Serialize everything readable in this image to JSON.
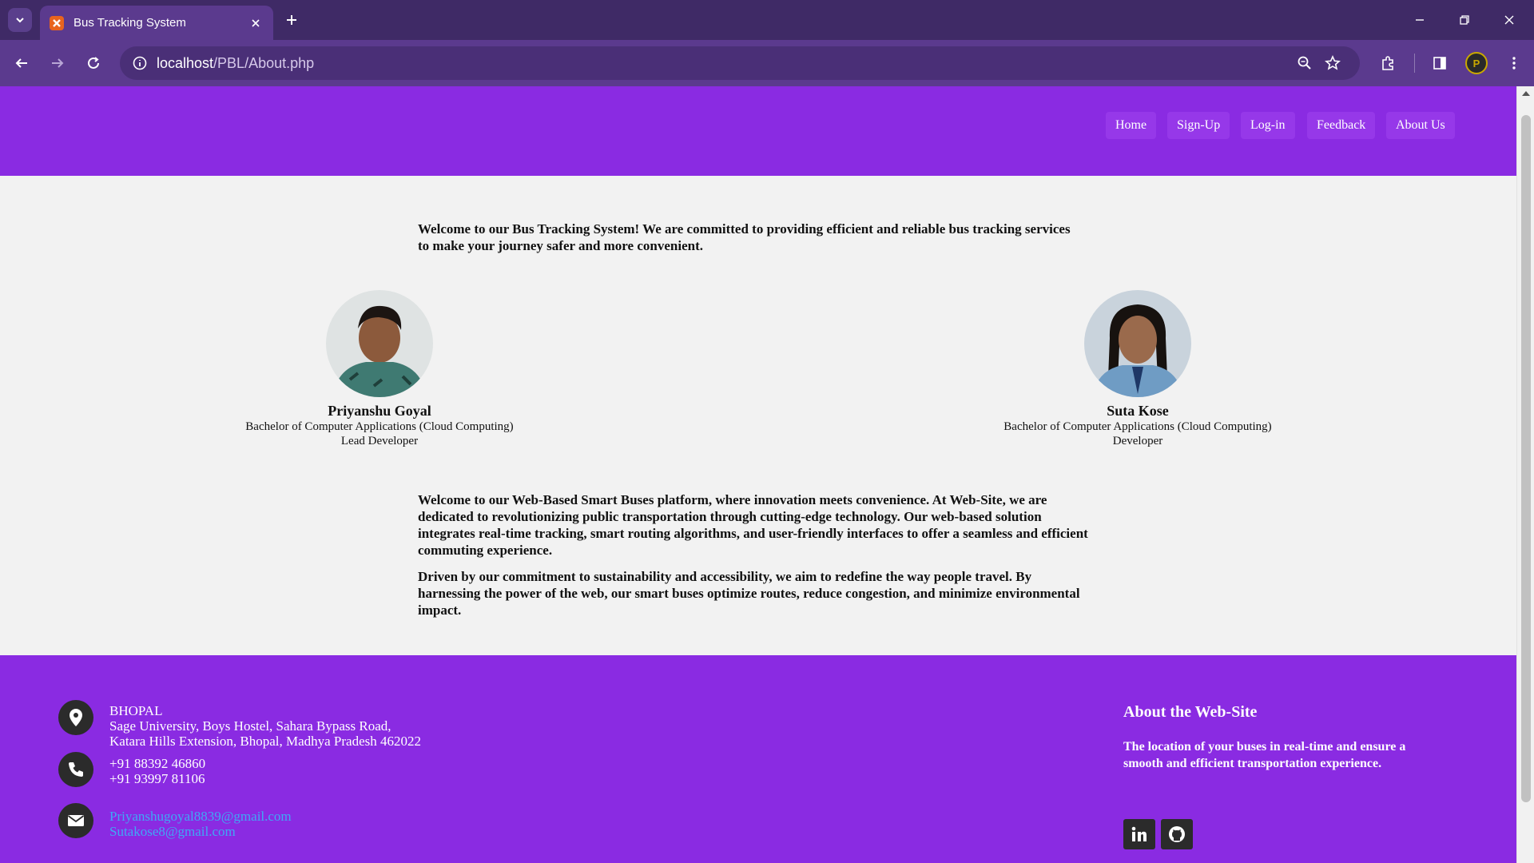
{
  "browser": {
    "tab_title": "Bus Tracking System",
    "url_host": "localhost",
    "url_path": "/PBL/About.php",
    "profile_initial": "P"
  },
  "header": {
    "nav": [
      "Home",
      "Sign-Up",
      "Log-in",
      "Feedback",
      "About Us"
    ]
  },
  "intro": "Welcome to our Bus Tracking System! We are committed to providing efficient and reliable bus tracking services to make your journey safer and more convenient.",
  "team": [
    {
      "name": "Priyanshu Goyal",
      "degree": "Bachelor of Computer Applications (Cloud Computing)",
      "role": "Lead Developer"
    },
    {
      "name": "Suta Kose",
      "degree": "Bachelor of Computer Applications (Cloud Computing)",
      "role": "Developer"
    }
  ],
  "about_paragraphs": [
    "Welcome to our Web-Based Smart Buses platform, where innovation meets convenience. At Web-Site, we are dedicated to revolutionizing public transportation through cutting-edge technology. Our web-based solution integrates real-time tracking, smart routing algorithms, and user-friendly interfaces to offer a seamless and efficient commuting experience.",
    "Driven by our commitment to sustainability and accessibility, we aim to redefine the way people travel. By harnessing the power of the web, our smart buses optimize routes, reduce congestion, and minimize environmental impact."
  ],
  "footer": {
    "address": {
      "city": "BHOPAL",
      "line1": "Sage University, Boys Hostel, Sahara Bypass Road,",
      "line2": "Katara Hills Extension, Bhopal, Madhya Pradesh 462022"
    },
    "phones": [
      "+91 88392 46860",
      "+91 93997 81106"
    ],
    "emails": [
      "Priyanshugoyal8839@gmail.com",
      "Sutakose8@gmail.com"
    ],
    "about_title": "About the Web-Site",
    "about_text": "The location of your buses in real-time and ensure a smooth and efficient transportation experience.",
    "social_icons": [
      "linkedin-icon",
      "github-icon"
    ]
  },
  "colors": {
    "browser_frame": "#3f2a66",
    "toolbar": "#5b3a8e",
    "brand_purple": "#8a2be2",
    "link_blue": "#3fa9f5",
    "icon_dark": "#2b2b2b"
  }
}
